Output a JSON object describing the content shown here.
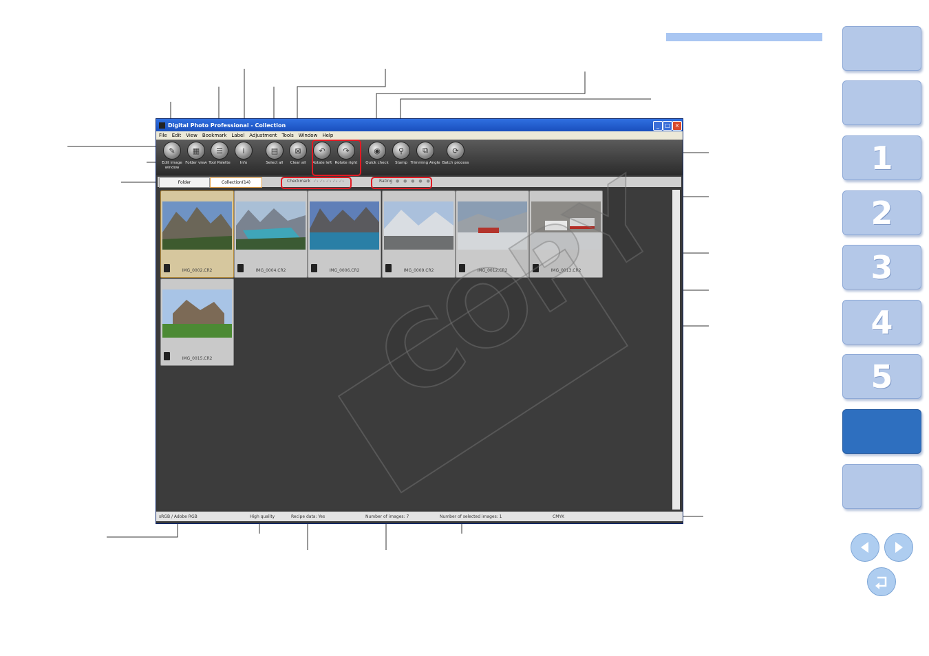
{
  "nav": {
    "tabs": [
      "",
      "",
      "1",
      "2",
      "3",
      "4",
      "5",
      "",
      ""
    ],
    "active_index": 7
  },
  "window": {
    "title": "Digital Photo Professional - Collection",
    "menu": [
      "File",
      "Edit",
      "View",
      "Bookmark",
      "Label",
      "Adjustment",
      "Tools",
      "Window",
      "Help"
    ],
    "toolbar": [
      {
        "label": "Edit image window",
        "icon": "edit-image-icon"
      },
      {
        "label": "Folder view",
        "icon": "folder-view-icon"
      },
      {
        "label": "Tool Palette",
        "icon": "tool-palette-icon"
      },
      {
        "label": "Info",
        "icon": "info-icon"
      },
      {
        "label": "Select all",
        "icon": "select-all-icon"
      },
      {
        "label": "Clear all",
        "icon": "clear-all-icon"
      },
      {
        "label": "Rotate left",
        "icon": "rotate-left-icon"
      },
      {
        "label": "Rotate right",
        "icon": "rotate-right-icon"
      },
      {
        "label": "Quick check",
        "icon": "quick-check-icon"
      },
      {
        "label": "Stamp",
        "icon": "stamp-icon"
      },
      {
        "label": "Trimming Angle",
        "icon": "trimming-angle-icon"
      },
      {
        "label": "Batch process",
        "icon": "batch-process-icon"
      }
    ],
    "tabs": {
      "folder": "Folder",
      "collection": "Collection(14)"
    },
    "filters": {
      "checkmark": "Checkmark",
      "checkmark_marks": "✓₁ ✓₂ ✓₃ ✓₄ ✓₅",
      "rating": "Rating",
      "rating_dots": "● ● ● ● ●"
    },
    "thumbnails": [
      {
        "file": "IMG_0002.CR2",
        "selected": true
      },
      {
        "file": "IMG_0004.CR2",
        "selected": false
      },
      {
        "file": "IMG_0006.CR2",
        "selected": false
      },
      {
        "file": "IMG_0009.CR2",
        "selected": false
      },
      {
        "file": "IMG_0012.CR2",
        "selected": false
      },
      {
        "file": "IMG_0013.CR2",
        "selected": false
      },
      {
        "file": "IMG_0015.CR2",
        "selected": false
      }
    ],
    "status": {
      "color_space": "sRGB / Adobe RGB",
      "quality": "High quality",
      "recipe": "Recipe data: Yes",
      "count": "Number of images: 7",
      "selected": "Number of selected images: 1",
      "cmyk": "CMYK"
    }
  },
  "watermark": "COPY"
}
